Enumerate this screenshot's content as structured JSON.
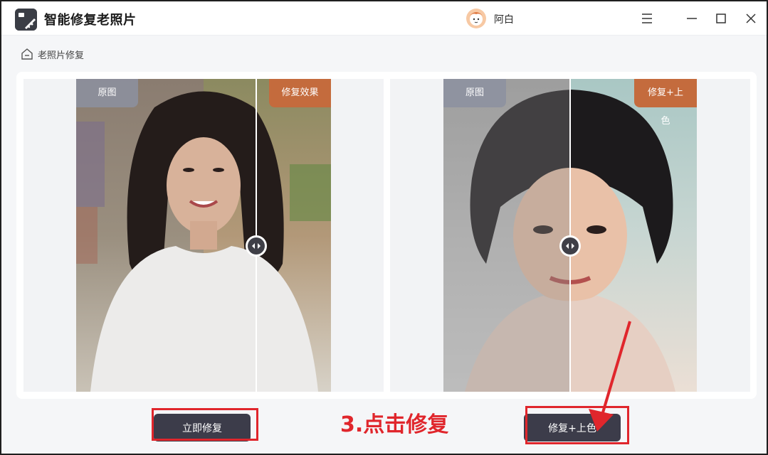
{
  "app": {
    "title": "智能修复老照片",
    "user_name": "阿白"
  },
  "breadcrumb": {
    "label": "老照片修复"
  },
  "cards": [
    {
      "tag_original": "原图",
      "tag_result": "修复效果"
    },
    {
      "tag_original": "原图",
      "tag_result": "修复+上色"
    }
  ],
  "buttons": {
    "repair_now": "立即修复",
    "repair_colorize": "修复+上色"
  },
  "annotation": {
    "text": "3.点击修复"
  },
  "colors": {
    "accent_red": "#e0262c",
    "button_dark": "#3c3c4a",
    "tag_orange": "#c46b3d",
    "tag_gray": "#8c91a0"
  },
  "icons": {
    "app": "photo-restore-icon",
    "avatar": "user-avatar-icon",
    "menu": "hamburger-menu-icon",
    "minimize": "minimize-icon",
    "maximize": "maximize-icon",
    "close": "close-icon",
    "home": "home-icon",
    "handle": "compare-slider-icon",
    "arrow": "red-arrow-icon"
  }
}
